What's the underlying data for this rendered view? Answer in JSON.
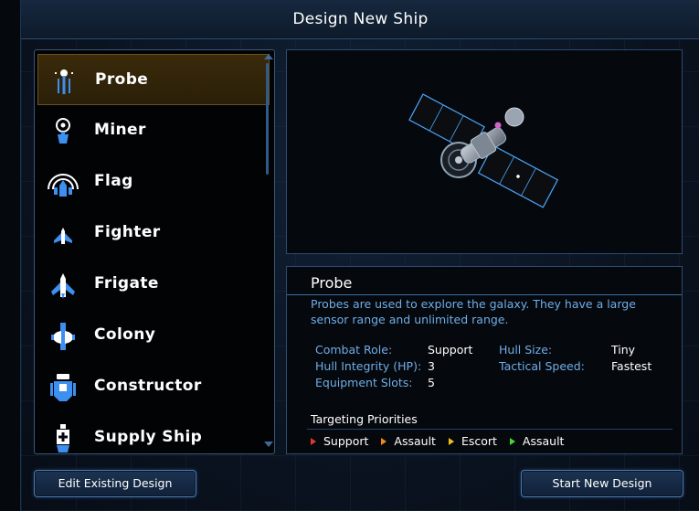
{
  "title": "Design New Ship",
  "ships": [
    {
      "label": "Probe",
      "icon": "probe-icon"
    },
    {
      "label": "Miner",
      "icon": "miner-icon"
    },
    {
      "label": "Flag",
      "icon": "flag-icon"
    },
    {
      "label": "Fighter",
      "icon": "fighter-icon"
    },
    {
      "label": "Frigate",
      "icon": "frigate-icon"
    },
    {
      "label": "Colony",
      "icon": "colony-icon"
    },
    {
      "label": "Constructor",
      "icon": "constructor-icon"
    },
    {
      "label": "Supply Ship",
      "icon": "supply-ship-icon"
    }
  ],
  "selected_ship": "Probe",
  "detail": {
    "name": "Probe",
    "description": "Probes are used to explore the galaxy. They have a large sensor range and unlimited range.",
    "stats": {
      "combat_role_label": "Combat Role:",
      "combat_role_value": "Support",
      "hull_integrity_label": "Hull Integrity (HP):",
      "hull_integrity_value": "3",
      "equipment_slots_label": "Equipment Slots:",
      "equipment_slots_value": "5",
      "hull_size_label": "Hull Size:",
      "hull_size_value": "Tiny",
      "tactical_speed_label": "Tactical Speed:",
      "tactical_speed_value": "Fastest"
    },
    "targeting_title": "Targeting Priorities",
    "targeting": [
      {
        "label": "Support",
        "color": "#e23a2a"
      },
      {
        "label": "Assault",
        "color": "#f08a1a"
      },
      {
        "label": "Escort",
        "color": "#f0c01a"
      },
      {
        "label": "Assault",
        "color": "#4ed23a"
      }
    ]
  },
  "buttons": {
    "edit_label": "Edit Existing Design",
    "start_label": "Start New Design"
  },
  "colors": {
    "accent": "#4a7cb3",
    "label_blue": "#6faee8",
    "selected_bg": "#3a2a0a"
  }
}
